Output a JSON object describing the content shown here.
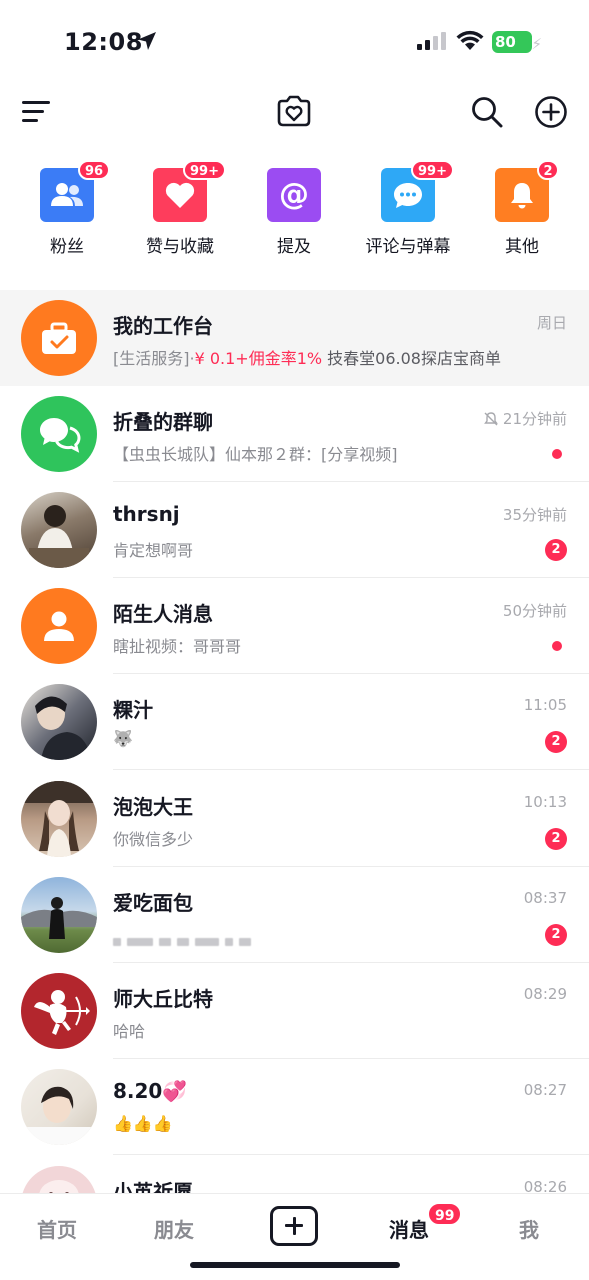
{
  "status_bar": {
    "time": "12:08",
    "battery": "80"
  },
  "top_nav": {
    "icons": [
      "menu-icon",
      "camera-heart-icon",
      "search-icon",
      "add-circle-icon"
    ]
  },
  "categories": [
    {
      "label": "粉丝",
      "badge": "96",
      "color": "#3b7cf6",
      "icon": "people-icon"
    },
    {
      "label": "赞与收藏",
      "badge": "99+",
      "color": "#fe3d5c",
      "icon": "heart-icon"
    },
    {
      "label": "提及",
      "badge": "",
      "color": "#9b4cf2",
      "icon": "at-icon"
    },
    {
      "label": "评论与弹幕",
      "badge": "99+",
      "color": "#2ea8f6",
      "icon": "chat-bubble-icon"
    },
    {
      "label": "其他",
      "badge": "2",
      "color": "#ff7e22",
      "icon": "bell-icon"
    }
  ],
  "conversations": [
    {
      "name": "我的工作台",
      "time": "周日",
      "preview_prefix": "[生活服务]·",
      "preview_highlight": "¥ 0.1+佣金率1%",
      "preview_suffix": " 技春堂06.08探店宝商单",
      "avatar": "briefcase-icon",
      "avatar_color": "#ff7a1f"
    },
    {
      "name": "折叠的群聊",
      "time": "21分钟前",
      "preview": "【虫虫长城队】仙本那２群：[分享视频]",
      "avatar": "group-chat-icon",
      "avatar_color": "#2fc45c",
      "muted": true,
      "dot": true
    },
    {
      "name": "thrsnj",
      "time": "35分钟前",
      "preview": "肯定想啊哥",
      "badge": "2",
      "avatar": "user-photo-thrsnj",
      "avatar_color": "#8a7a6a"
    },
    {
      "name": "陌生人消息",
      "time": "50分钟前",
      "preview": "瞎扯视频：哥哥哥",
      "avatar": "person-icon",
      "avatar_color": "#ff7a1f",
      "dot": true
    },
    {
      "name": "粿汁",
      "time": "11:05",
      "preview": "🐺",
      "badge": "2",
      "avatar": "user-photo-guozhi",
      "avatar_color": "#3a3f4a"
    },
    {
      "name": "泡泡大王",
      "time": "10:13",
      "preview": "你微信多少",
      "badge": "2",
      "avatar": "user-photo-paopao",
      "avatar_color": "#b89a84"
    },
    {
      "name": "爱吃面包",
      "time": "08:37",
      "preview_blurred": true,
      "badge": "2",
      "avatar": "user-photo-aichi",
      "avatar_color": "#6f8fb2"
    },
    {
      "name": "师大丘比特",
      "time": "08:29",
      "preview": "哈哈",
      "avatar": "cupid-logo",
      "avatar_color": "#b3262d"
    },
    {
      "name": "8.20💞",
      "time": "08:27",
      "preview": "👍👍👍",
      "avatar": "user-photo-820",
      "avatar_color": "#e7e1d8"
    },
    {
      "name": "小茧祈愿",
      "time": "08:26",
      "preview": "",
      "avatar": "user-photo-xiaojian",
      "avatar_color": "#f2d6d8"
    }
  ],
  "tab_bar": {
    "tabs": [
      "首页",
      "朋友",
      "消息",
      "我"
    ],
    "messages_badge": "99"
  }
}
